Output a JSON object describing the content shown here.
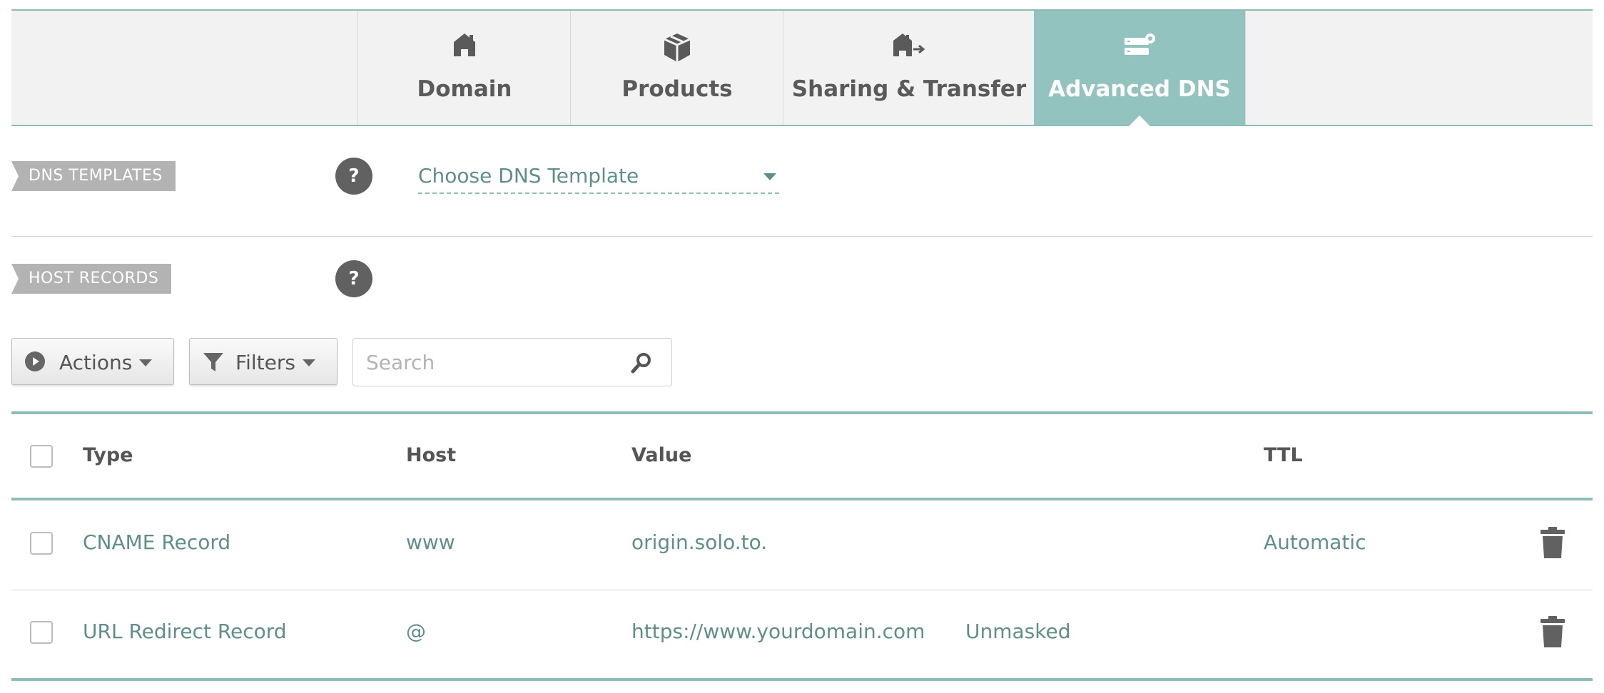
{
  "tabs": [
    {
      "label": "Domain",
      "icon": "home-icon"
    },
    {
      "label": "Products",
      "icon": "box-icon"
    },
    {
      "label": "Sharing & Transfer",
      "icon": "home-transfer-icon"
    },
    {
      "label": "Advanced DNS",
      "icon": "dns-server-icon",
      "active": true
    }
  ],
  "dns_templates": {
    "label": "DNS TEMPLATES",
    "help": "?",
    "select_value": "Choose DNS Template"
  },
  "host_records": {
    "label": "HOST RECORDS",
    "help": "?"
  },
  "toolbar": {
    "actions_label": "Actions",
    "filters_label": "Filters",
    "search_placeholder": "Search"
  },
  "table": {
    "headers": {
      "type": "Type",
      "host": "Host",
      "value": "Value",
      "ttl": "TTL"
    },
    "rows": [
      {
        "type": "CNAME Record",
        "host": "www",
        "value": "origin.solo.to.",
        "extra": "",
        "ttl": "Automatic"
      },
      {
        "type": "URL Redirect Record",
        "host": "@",
        "value": "https://www.yourdomain.com",
        "extra": "Unmasked",
        "ttl": ""
      }
    ]
  },
  "colors": {
    "accent": "#93c3bf",
    "link_text": "#5f8f8b",
    "tab_bg": "#f2f2f2"
  }
}
